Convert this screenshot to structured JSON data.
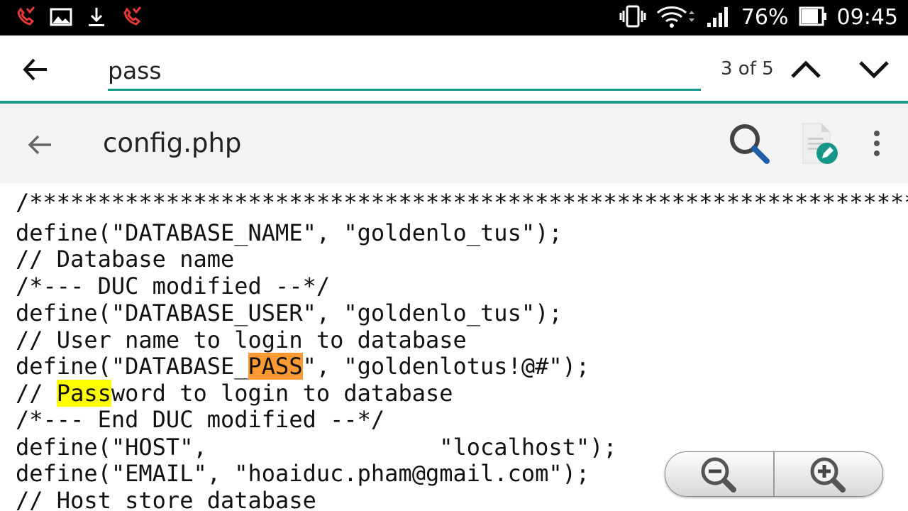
{
  "status_bar": {
    "battery_percent": "76%",
    "time": "09:45",
    "left_icons": [
      "missed-call-icon",
      "gallery-icon",
      "download-icon",
      "missed-call-icon"
    ],
    "right_icons": [
      "vibrate-icon",
      "wifi-icon",
      "signal-icon",
      "battery-icon"
    ]
  },
  "find_bar": {
    "query": "pass",
    "match_count": "3 of 5"
  },
  "toolbar": {
    "title": "config.php"
  },
  "colors": {
    "accent": "#1a9a8c",
    "current_match": "#ff9933",
    "other_match": "#ffff00",
    "missed_call": "#e53935"
  },
  "code": {
    "lines": [
      {
        "segments": [
          "/*******************************************************************"
        ]
      },
      {
        "segments": [
          "define(\"DATABASE_NAME\", \"goldenlo_tus\");"
        ]
      },
      {
        "segments": [
          "// Database name"
        ]
      },
      {
        "segments": [
          "/*--- DUC modified --*/"
        ]
      },
      {
        "segments": [
          "define(\"DATABASE_USER\", \"goldenlo_tus\");"
        ]
      },
      {
        "segments": [
          "// User name to login to database"
        ]
      },
      {
        "segments": [
          "define(\"DATABASE_",
          "PASS",
          "\", \"goldenlotus!@#\");"
        ]
      },
      {
        "segments": [
          "// ",
          "Pass",
          "word to login to database"
        ]
      },
      {
        "segments": [
          "/*--- End DUC modified --*/"
        ]
      },
      {
        "segments": [
          "define(\"HOST\",                 \"localhost\");"
        ]
      },
      {
        "segments": [
          "define(\"EMAIL\", \"hoaiduc.pham@gmail.com\");"
        ]
      },
      {
        "segments": [
          "// Host store database"
        ]
      }
    ]
  }
}
